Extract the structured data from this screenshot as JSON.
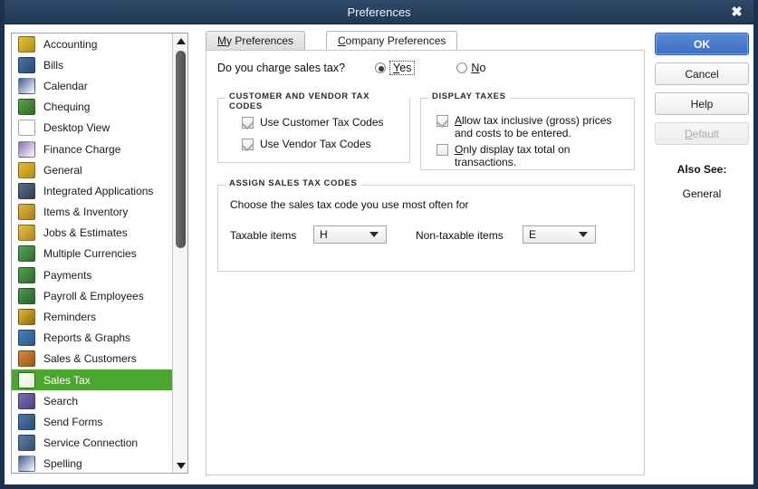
{
  "window": {
    "title": "Preferences",
    "close_label": "✖"
  },
  "sidebar": {
    "items": [
      {
        "label": "Accounting",
        "icon": "accounting-icon",
        "color": "#e8c440",
        "color2": "#b08a12"
      },
      {
        "label": "Bills",
        "icon": "bills-icon",
        "color": "#4a6fa8",
        "color2": "#2d4a77"
      },
      {
        "label": "Calendar",
        "icon": "calendar-icon",
        "color": "#3f6196",
        "color2": "#ffffff"
      },
      {
        "label": "Chequing",
        "icon": "chequing-icon",
        "color": "#5aa34a",
        "color2": "#2f6b26"
      },
      {
        "label": "Desktop View",
        "icon": "desktop-view-icon",
        "color": "#9b7fc0",
        "color2": "#6d54916"
      },
      {
        "label": "Finance Charge",
        "icon": "finance-charge-icon",
        "color": "#8e6cb3",
        "color2": "#ffffff"
      },
      {
        "label": "General",
        "icon": "general-icon",
        "color": "#e2b93a",
        "color2": "#b48c12"
      },
      {
        "label": "Integrated Applications",
        "icon": "integrated-applications-icon",
        "color": "#5b6e86",
        "color2": "#2f3f52"
      },
      {
        "label": "Items & Inventory",
        "icon": "items-inventory-icon",
        "color": "#e0b63c",
        "color2": "#a8801a"
      },
      {
        "label": "Jobs & Estimates",
        "icon": "jobs-estimates-icon",
        "color": "#e6c24a",
        "color2": "#ab8518"
      },
      {
        "label": "Multiple Currencies",
        "icon": "multiple-currencies-icon",
        "color": "#5aa559",
        "color2": "#2e6b2d"
      },
      {
        "label": "Payments",
        "icon": "payments-icon",
        "color": "#55a24e",
        "color2": "#2c6a28"
      },
      {
        "label": "Payroll & Employees",
        "icon": "payroll-employees-icon",
        "color": "#4d9c4a",
        "color2": "#27612a"
      },
      {
        "label": "Reminders",
        "icon": "reminders-icon",
        "color": "#e2b63a",
        "color2": "#8d6a10"
      },
      {
        "label": "Reports & Graphs",
        "icon": "reports-graphs-icon",
        "color": "#4a7fb5",
        "color2": "#2b5a8a"
      },
      {
        "label": "Sales & Customers",
        "icon": "sales-customers-icon",
        "color": "#d98b3c",
        "color2": "#99551a"
      },
      {
        "label": "Sales Tax",
        "icon": "sales-tax-icon",
        "color": "#ffffff",
        "color2": "#ffffff",
        "selected": true
      },
      {
        "label": "Search",
        "icon": "search-icon",
        "color": "#7b6fb0",
        "color2": "#4b4180"
      },
      {
        "label": "Send Forms",
        "icon": "send-forms-icon",
        "color": "#4d79ab",
        "color2": "#2b4f78"
      },
      {
        "label": "Service Connection",
        "icon": "service-connection-icon",
        "color": "#5d7ea8",
        "color2": "#33506f"
      },
      {
        "label": "Spelling",
        "icon": "spelling-icon",
        "color": "#3f5d91",
        "color2": "#ffffff"
      }
    ],
    "selected_label": "Sales Tax",
    "selected_color": "#4aa62c",
    "scrollbar": {
      "up_arrow": "▲",
      "down_arrow": "▼"
    }
  },
  "tabs": [
    {
      "label": "My Preferences",
      "accel": "M",
      "active": false
    },
    {
      "label": "Company Preferences",
      "accel": "C",
      "active": true
    }
  ],
  "main": {
    "question": "Do you charge sales tax?",
    "radios": [
      {
        "label": "Yes",
        "accel": "Y",
        "selected": true,
        "focused": true
      },
      {
        "label": "No",
        "accel": "N",
        "selected": false,
        "focused": false
      }
    ],
    "customer_vendor_group": {
      "title": "CUSTOMER AND VENDOR TAX CODES",
      "checkboxes": [
        {
          "label": "Use Customer Tax Codes",
          "checked": true
        },
        {
          "label": "Use Vendor Tax Codes",
          "checked": true
        }
      ]
    },
    "display_taxes_group": {
      "title": "DISPLAY TAXES",
      "checkboxes": [
        {
          "line1": "Allow tax inclusive (gross) prices",
          "line2": "and costs to be entered.",
          "accel": "A",
          "checked": true
        },
        {
          "line1": "Only display tax total on",
          "line2": "transactions.",
          "accel": "O",
          "checked": false
        }
      ]
    },
    "assign_group": {
      "title": "ASSIGN SALES TAX CODES",
      "lead": "Choose the sales tax code you use most often for",
      "fields": [
        {
          "label": "Taxable items",
          "value": "H"
        },
        {
          "label": "Non-taxable items",
          "value": "E"
        }
      ]
    }
  },
  "buttons": [
    {
      "label": "OK",
      "style": "primary",
      "accel": ""
    },
    {
      "label": "Cancel",
      "style": "normal",
      "accel": ""
    },
    {
      "label": "Help",
      "style": "normal",
      "accel": ""
    },
    {
      "label": "Default",
      "style": "disabled",
      "accel": "D"
    }
  ],
  "also_see": {
    "heading": "Also See:",
    "link": "General"
  },
  "colors": {
    "titlebar": "#27405f",
    "selection_green": "#4aa62c",
    "primary_button": "#3c6fc4",
    "border": "#1d3050"
  }
}
